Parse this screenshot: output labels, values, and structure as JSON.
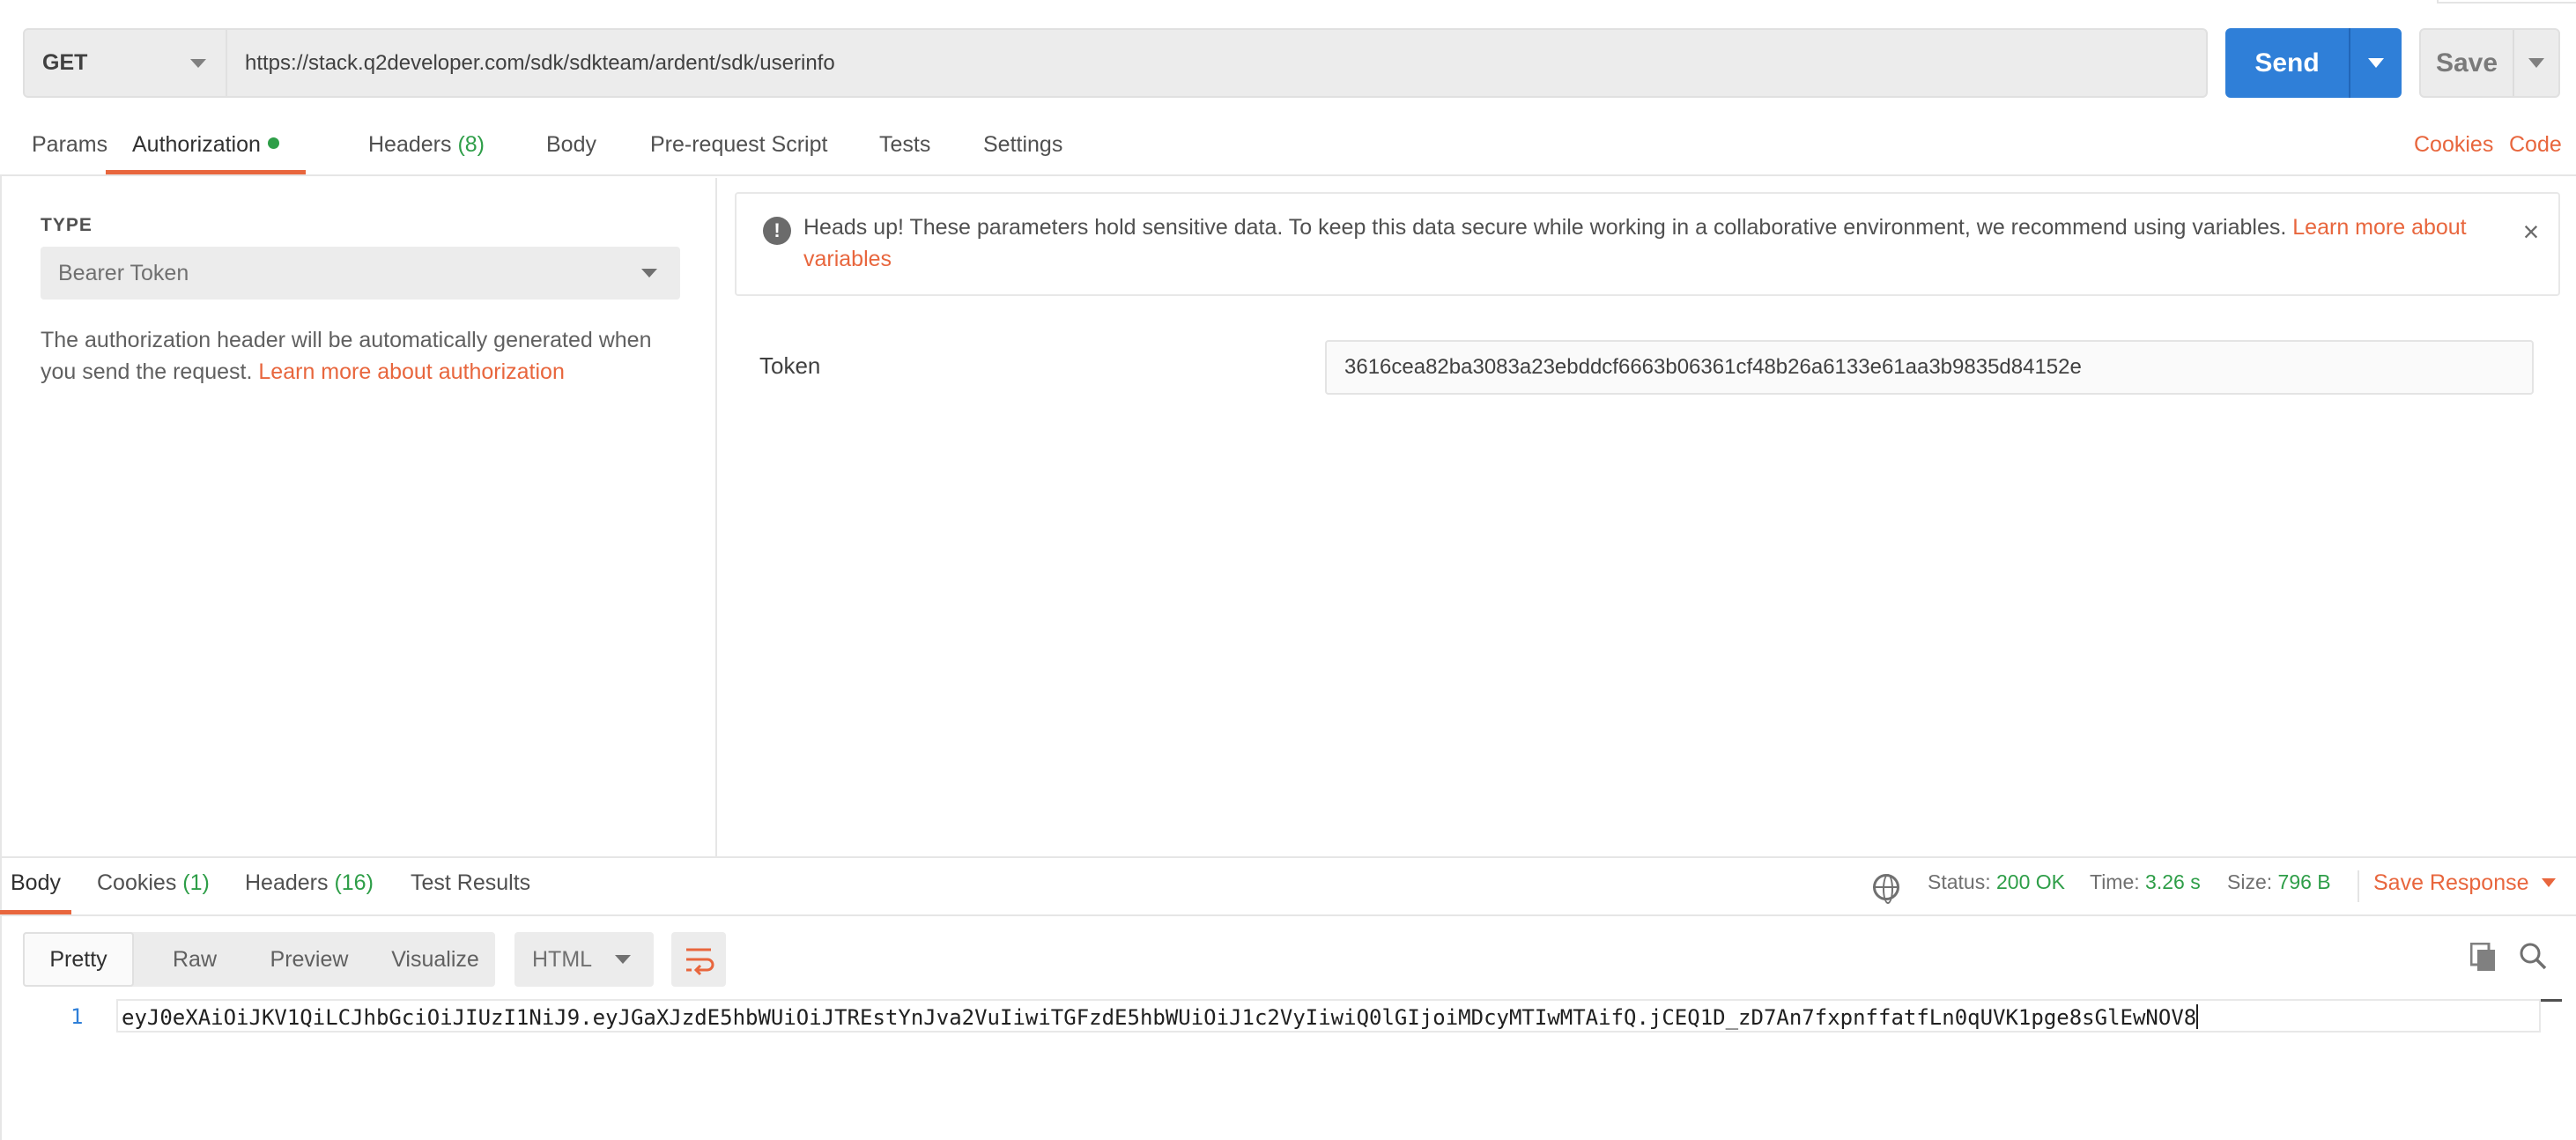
{
  "request": {
    "method": "GET",
    "url": "https://stack.q2developer.com/sdk/sdkteam/ardent/sdk/userinfo",
    "send_label": "Send",
    "save_label": "Save"
  },
  "request_tabs": {
    "params": "Params",
    "authorization": "Authorization",
    "headers": "Headers",
    "headers_count": "(8)",
    "body": "Body",
    "pre_request": "Pre-request Script",
    "tests": "Tests",
    "settings": "Settings",
    "cookies": "Cookies",
    "code": "Code"
  },
  "auth": {
    "type_label": "TYPE",
    "type_value": "Bearer Token",
    "description": "The authorization header will be automatically generated when you send the request.",
    "description_link": "Learn more about authorization",
    "notice_text": "Heads up! These parameters hold sensitive data. To keep this data secure while working in a collaborative environment, we recommend using variables.",
    "notice_link": "Learn more about variables",
    "token_label": "Token",
    "token_value": "3616cea82ba3083a23ebddcf6663b06361cf48b26a6133e61aa3b9835d84152e"
  },
  "response_tabs": {
    "body": "Body",
    "cookies": "Cookies",
    "cookies_count": "(1)",
    "headers": "Headers",
    "headers_count": "(16)",
    "test_results": "Test Results"
  },
  "response_status": {
    "status_label": "Status:",
    "status_value": "200 OK",
    "time_label": "Time:",
    "time_value": "3.26 s",
    "size_label": "Size:",
    "size_value": "796 B",
    "save_response": "Save Response"
  },
  "response_view": {
    "modes": [
      "Pretty",
      "Raw",
      "Preview",
      "Visualize"
    ],
    "format": "HTML",
    "line_number": "1",
    "content": "eyJ0eXAiOiJKV1QiLCJhbGciOiJIUzI1NiJ9.eyJGaXJzdE5hbWUiOiJTREstYnJva2VuIiwiTGFzdE5hbWUiOiJ1c2VyIiwiQ0lGIjoiMDcyMTIwMTAifQ.jCEQ1D_zD7An7fxpnffatfLn0qUVK1pge8sGlEwNOV8"
  },
  "colors": {
    "accent": "#e8663d",
    "send_blue": "#2f7fd8",
    "success_green": "#2e9e48"
  },
  "icons": [
    "chevron-down-icon",
    "info-icon",
    "close-icon",
    "globe-icon",
    "wrap-lines-icon",
    "copy-icon",
    "search-icon"
  ]
}
